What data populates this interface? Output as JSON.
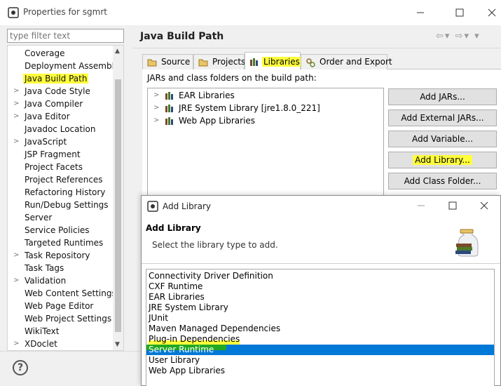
{
  "window": {
    "title": "Properties for sgmrt"
  },
  "filter": {
    "placeholder": "type filter text"
  },
  "tree": {
    "items": [
      {
        "label": "Coverage",
        "expandable": false
      },
      {
        "label": "Deployment Assembly",
        "expandable": false
      },
      {
        "label": "Java Build Path",
        "expandable": false,
        "highlighted": true
      },
      {
        "label": "Java Code Style",
        "expandable": true
      },
      {
        "label": "Java Compiler",
        "expandable": true
      },
      {
        "label": "Java Editor",
        "expandable": true
      },
      {
        "label": "Javadoc Location",
        "expandable": false
      },
      {
        "label": "JavaScript",
        "expandable": true
      },
      {
        "label": "JSP Fragment",
        "expandable": false
      },
      {
        "label": "Project Facets",
        "expandable": false
      },
      {
        "label": "Project References",
        "expandable": false
      },
      {
        "label": "Refactoring History",
        "expandable": false
      },
      {
        "label": "Run/Debug Settings",
        "expandable": false
      },
      {
        "label": "Server",
        "expandable": false
      },
      {
        "label": "Service Policies",
        "expandable": false
      },
      {
        "label": "Targeted Runtimes",
        "expandable": false
      },
      {
        "label": "Task Repository",
        "expandable": true
      },
      {
        "label": "Task Tags",
        "expandable": false
      },
      {
        "label": "Validation",
        "expandable": true
      },
      {
        "label": "Web Content Settings",
        "expandable": false
      },
      {
        "label": "Web Page Editor",
        "expandable": false
      },
      {
        "label": "Web Project Settings",
        "expandable": false
      },
      {
        "label": "WikiText",
        "expandable": false
      },
      {
        "label": "XDoclet",
        "expandable": true
      }
    ]
  },
  "page": {
    "title": "Java Build Path"
  },
  "tabs": [
    {
      "label": "Source",
      "icon": "source-folder-icon"
    },
    {
      "label": "Projects",
      "icon": "projects-folder-icon"
    },
    {
      "label": "Libraries",
      "icon": "libraries-icon",
      "active": true
    },
    {
      "label": "Order and Export",
      "icon": "order-export-icon"
    }
  ],
  "libraries": {
    "caption": "JARs and class folders on the build path:",
    "items": [
      {
        "label": "EAR Libraries"
      },
      {
        "label": "JRE System Library [jre1.8.0_221]"
      },
      {
        "label": "Web App Libraries"
      }
    ]
  },
  "buttons": {
    "add_jars": "Add JARs...",
    "add_external_jars": "Add External JARs...",
    "add_variable": "Add Variable...",
    "add_library": "Add Library...",
    "add_class_folder": "Add Class Folder..."
  },
  "dialog": {
    "title": "Add Library",
    "heading": "Add Library",
    "description": "Select the library type to add.",
    "options": [
      {
        "label": "Connectivity Driver Definition"
      },
      {
        "label": "CXF Runtime"
      },
      {
        "label": "EAR Libraries"
      },
      {
        "label": "JRE System Library"
      },
      {
        "label": "JUnit"
      },
      {
        "label": "Maven Managed Dependencies"
      },
      {
        "label": "Plug-in Dependencies"
      },
      {
        "label": "Server Runtime",
        "selected": true
      },
      {
        "label": "User Library"
      },
      {
        "label": "Web App Libraries"
      }
    ]
  },
  "colors": {
    "highlight": "#ffff3c",
    "selection": "#0078d7",
    "marker_green": "#22a822"
  }
}
